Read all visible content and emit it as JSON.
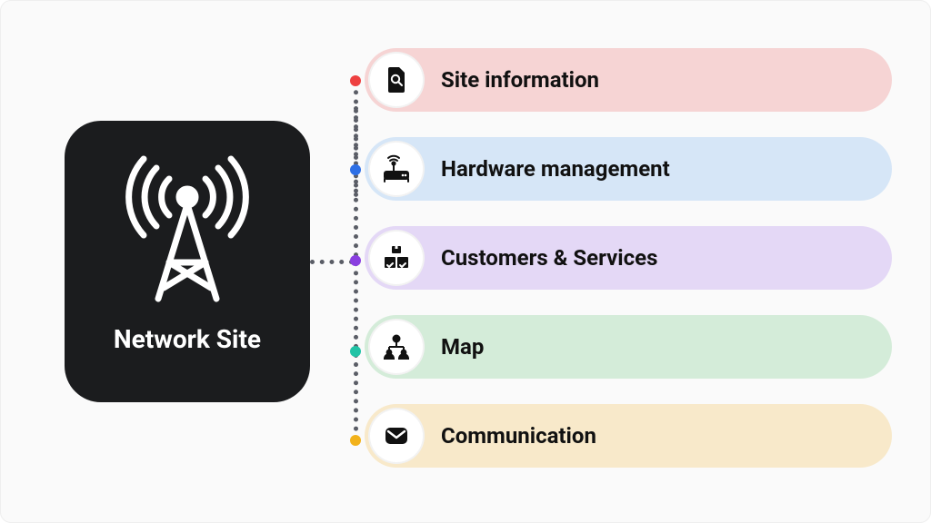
{
  "main": {
    "title": "Network Site",
    "icon": "antenna-tower-icon"
  },
  "categories": [
    {
      "key": "info",
      "label": "Site information",
      "bg": "#f6d4d4",
      "dot": "#ee4040",
      "icon": "file-search-icon"
    },
    {
      "key": "hw",
      "label": "Hardware management",
      "bg": "#d6e6f7",
      "dot": "#2d6fe6",
      "icon": "router-icon"
    },
    {
      "key": "cust",
      "label": "Customers & Services",
      "bg": "#e4d8f6",
      "dot": "#8a3fe0",
      "icon": "packages-icon"
    },
    {
      "key": "map",
      "label": "Map",
      "bg": "#d4ecd9",
      "dot": "#22c3a6",
      "icon": "nodes-icon"
    },
    {
      "key": "comm",
      "label": "Communication",
      "bg": "#f8e9ca",
      "dot": "#f2b21b",
      "icon": "mail-icon"
    }
  ]
}
